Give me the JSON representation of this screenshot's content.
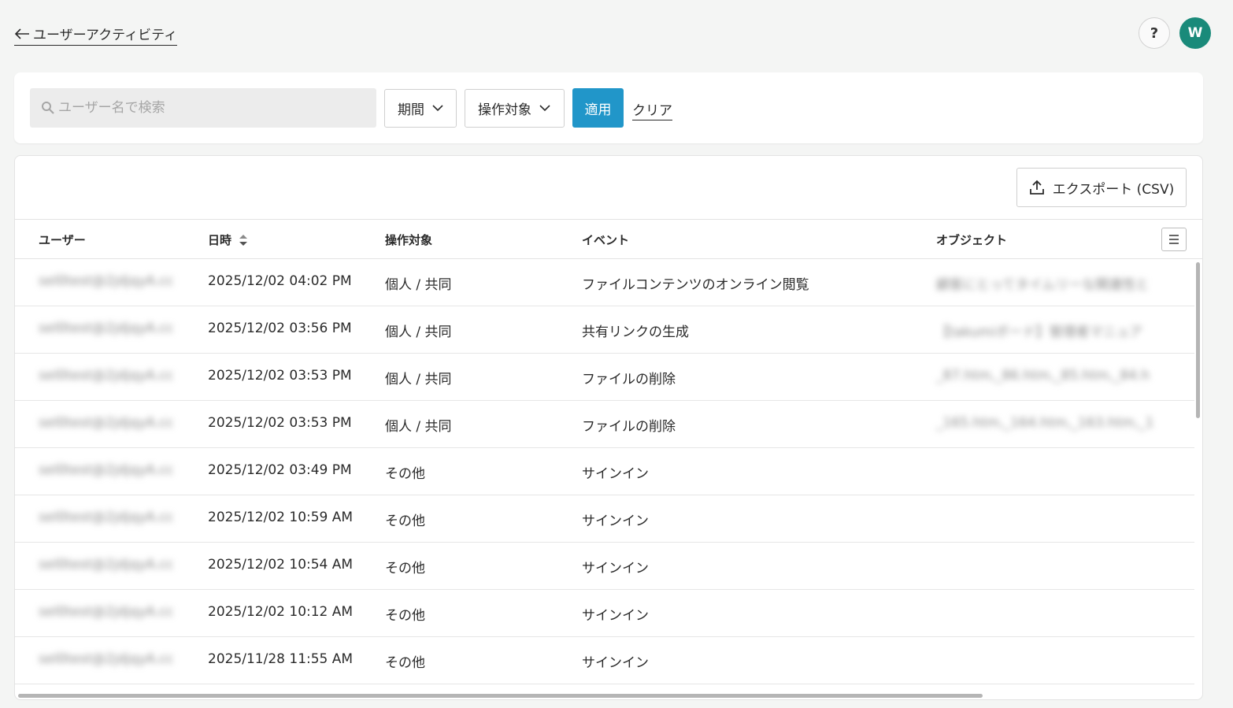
{
  "header": {
    "back_label": "ユーザーアクティビティ",
    "help_label": "?",
    "avatar_initial": "W",
    "avatar_color": "#1a8a7a"
  },
  "filters": {
    "search_placeholder": "ユーザー名で検索",
    "period_label": "期間",
    "target_label": "操作対象",
    "apply_label": "適用",
    "clear_label": "クリア",
    "accent_color": "#2196c9"
  },
  "table": {
    "export_label": "エクスポート (CSV)",
    "columns": [
      "ユーザー",
      "日時",
      "操作対象",
      "イベント",
      "オブジェクト"
    ],
    "rows": [
      {
        "user": "sel0test@2jdjqyA.co",
        "date": "2025/12/02 04:02 PM",
        "target": "個人 / 共同",
        "event": "ファイルコンテンツのオンライン閲覧",
        "object": "顧客にとってタイムリーな関連性と"
      },
      {
        "user": "sel0test@2jdjqyA.co",
        "date": "2025/12/02 03:56 PM",
        "target": "個人 / 共同",
        "event": "共有リンクの生成",
        "object": "【takumiボード】管理者マニュア"
      },
      {
        "user": "sel0test@2jdjqyA.co",
        "date": "2025/12/02 03:53 PM",
        "target": "個人 / 共同",
        "event": "ファイルの削除",
        "object": "_87.htm,_86.htm,_85.htm,_84.h"
      },
      {
        "user": "sel0test@2jdjqyA.co",
        "date": "2025/12/02 03:53 PM",
        "target": "個人 / 共同",
        "event": "ファイルの削除",
        "object": "_165.htm,_164.htm,_163.htm,_1"
      },
      {
        "user": "sel0test@2jdjqyA.co",
        "date": "2025/12/02 03:49 PM",
        "target": "その他",
        "event": "サインイン",
        "object": ""
      },
      {
        "user": "sel0test@2jdjqyA.co",
        "date": "2025/12/02 10:59 AM",
        "target": "その他",
        "event": "サインイン",
        "object": ""
      },
      {
        "user": "sel0test@2jdjqyA.co",
        "date": "2025/12/02 10:54 AM",
        "target": "その他",
        "event": "サインイン",
        "object": ""
      },
      {
        "user": "sel0test@2jdjqyA.co",
        "date": "2025/12/02 10:12 AM",
        "target": "その他",
        "event": "サインイン",
        "object": ""
      },
      {
        "user": "sel0test@2jdjqyA.co",
        "date": "2025/11/28 11:55 AM",
        "target": "その他",
        "event": "サインイン",
        "object": ""
      }
    ]
  },
  "icons": {
    "back": "arrow-left-icon",
    "search": "search-icon",
    "chevron": "chevron-down-icon",
    "export": "upload-icon",
    "sort": "sort-icon",
    "column_menu": "menu-icon"
  }
}
